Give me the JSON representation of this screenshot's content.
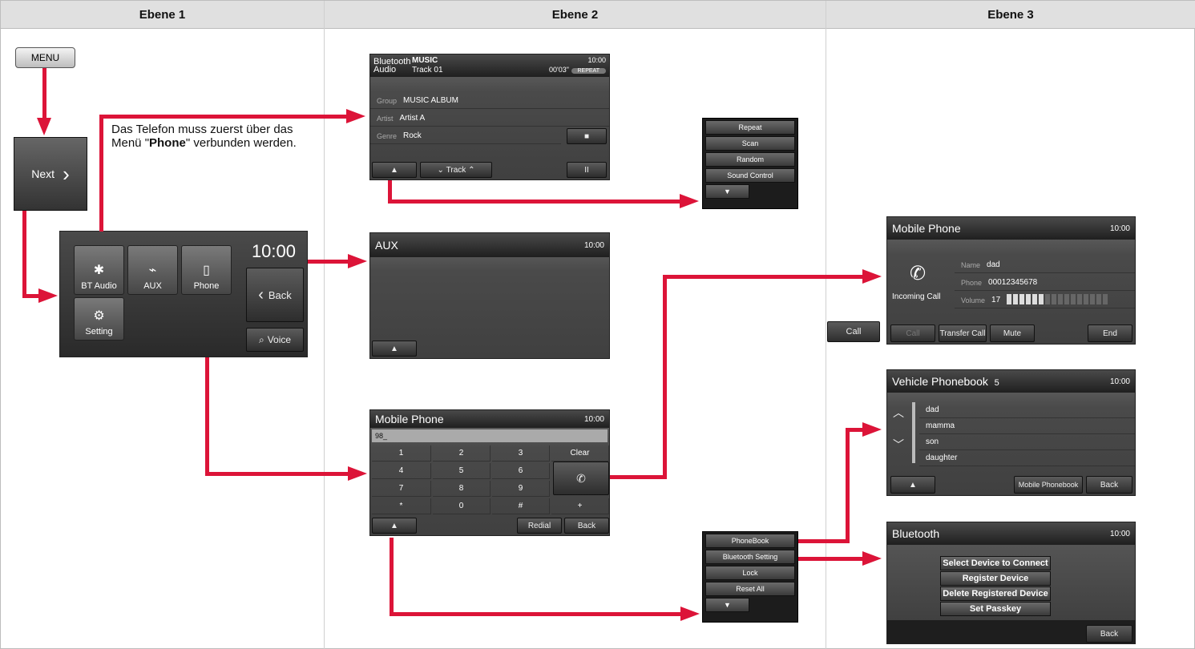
{
  "headers": [
    "Ebene 1",
    "Ebene 2",
    "Ebene 3"
  ],
  "level1": {
    "menu_button": "MENU",
    "next_button": "Next",
    "next_chevron": "›",
    "note_part1": "Das Telefon muss zuerst über das Menü \"",
    "note_bold": "Phone",
    "note_part2": "\" verbunden werden."
  },
  "main_menu": {
    "clock": "10:00",
    "tiles": [
      "BT Audio",
      "AUX",
      "Phone",
      "Setting"
    ],
    "back": "Back",
    "voice": "Voice"
  },
  "bt_audio": {
    "brand": "Bluetooth Audio",
    "source": "MUSIC",
    "track": "Track 01",
    "time": "00'03\"",
    "repeat": "REPEAT",
    "clock": "10:00",
    "rows": [
      {
        "label": "Group",
        "value": "MUSIC ALBUM"
      },
      {
        "label": "Artist",
        "value": "Artist A"
      },
      {
        "label": "Genre",
        "value": "Rock"
      }
    ],
    "track_btn": "Track",
    "stop": "■",
    "pause": "II",
    "up": "▲"
  },
  "bt_menu": {
    "items": [
      "Repeat",
      "Scan",
      "Random",
      "Sound Control"
    ],
    "down": "▼"
  },
  "aux": {
    "title": "AUX",
    "clock": "10:00",
    "up": "▲"
  },
  "phone_dial": {
    "title": "Mobile Phone",
    "clock": "10:00",
    "entry": "98_",
    "keys": [
      "1",
      "2",
      "3",
      "Clear",
      "4",
      "5",
      "6",
      "",
      "7",
      "8",
      "9",
      "",
      "*",
      "0",
      "#",
      "+"
    ],
    "redial": "Redial",
    "back": "Back",
    "up": "▲",
    "call_icon": "✆"
  },
  "phone_menu": {
    "items": [
      "PhoneBook",
      "Bluetooth Setting",
      "Lock",
      "Reset All"
    ],
    "down": "▼"
  },
  "incoming": {
    "title": "Mobile Phone",
    "clock": "10:00",
    "status": "Incoming Call",
    "name_label": "Name",
    "name": "dad",
    "phone_label": "Phone",
    "phone": "00012345678",
    "volume_label": "Volume",
    "volume": "17",
    "volume_level": 6,
    "volume_max": 16,
    "call": "Call",
    "buttons": [
      "Call",
      "Transfer Call",
      "Mute",
      "End"
    ]
  },
  "phonebook": {
    "title": "Vehicle Phonebook",
    "count": "5",
    "clock": "10:00",
    "entries": [
      "dad",
      "mamma",
      "son",
      "daughter"
    ],
    "mobile_pb": "Mobile Phonebook",
    "back": "Back",
    "up": "▲"
  },
  "bluetooth": {
    "title": "Bluetooth",
    "clock": "10:00",
    "items": [
      "Select Device to Connect",
      "Register Device",
      "Delete Registered Device",
      "Set Passkey"
    ],
    "back": "Back"
  },
  "colors": {
    "arrow": "#dc1438",
    "header_bg": "#e0e0e0"
  }
}
